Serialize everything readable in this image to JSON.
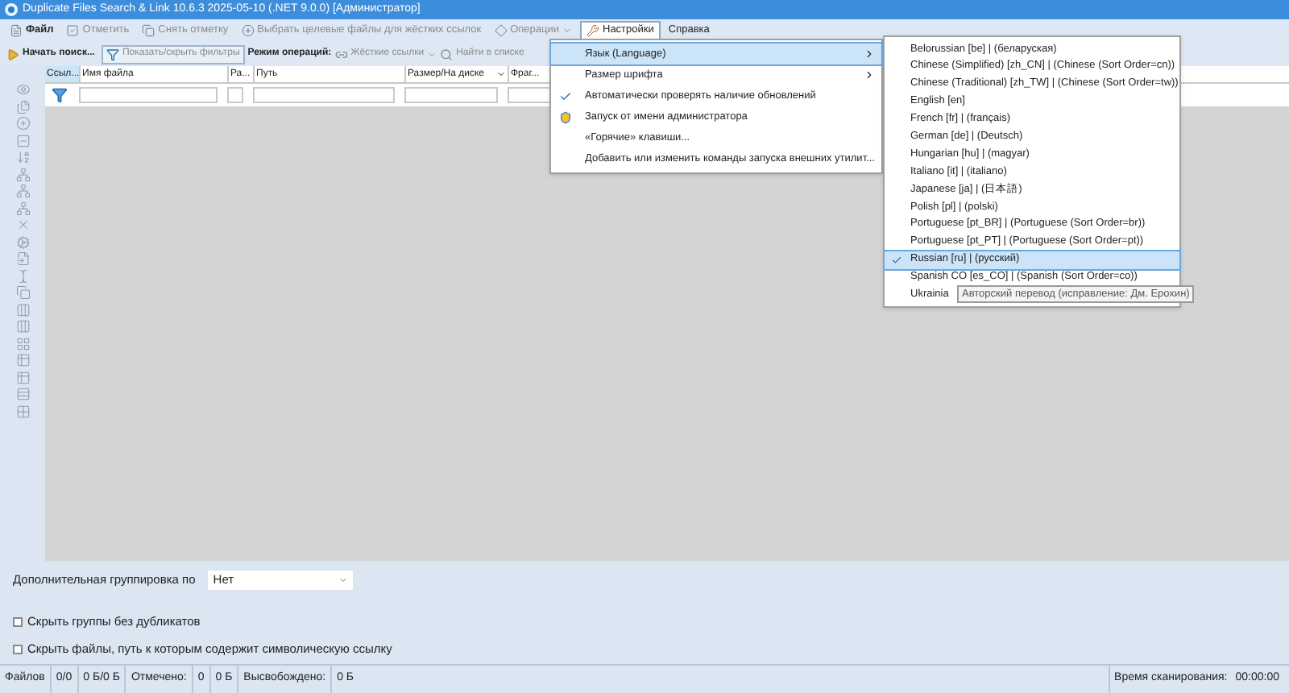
{
  "window": {
    "title": "Duplicate Files Search & Link 10.6.3 2025-05-10 (.NET 9.0.0) [Администратор]"
  },
  "menu_bar": [
    {
      "label": "Файл",
      "kind": "button",
      "disabled": false,
      "selected": false
    },
    {
      "label": "Отметить",
      "kind": "button",
      "disabled": true,
      "selected": false
    },
    {
      "label": "Снять отметку",
      "kind": "button",
      "disabled": true,
      "selected": false
    },
    {
      "label": "Выбрать целевые файлы для жёстких ссылок",
      "kind": "button",
      "disabled": true,
      "selected": false
    },
    {
      "label": "Операции",
      "kind": "dropdown",
      "disabled": true,
      "selected": false
    },
    {
      "label": "Настройки",
      "kind": "button",
      "disabled": false,
      "selected": true
    },
    {
      "label": "Справка",
      "kind": "plain",
      "disabled": false,
      "selected": false
    }
  ],
  "toolbar": {
    "start_search": "Начать поиск...",
    "filters_toggle": {
      "label": "Показать/скрыть фильтры",
      "disabled": true
    },
    "mode_label": "Режим операций:",
    "mode_value": {
      "label": "Жёсткие ссылки",
      "disabled": true
    },
    "find_in_list": {
      "label": "Найти в списке",
      "disabled": true
    }
  },
  "table": {
    "columns": [
      {
        "label": "Ссыл...",
        "selected": true
      },
      {
        "label": "Имя файла",
        "selected": false
      },
      {
        "label": "Ра...",
        "selected": false
      },
      {
        "label": "Путь",
        "selected": false
      },
      {
        "label": "Размер/На диске",
        "selected": false,
        "sortable": true
      },
      {
        "label": "Фраг...",
        "selected": false
      }
    ]
  },
  "settings_menu": [
    {
      "label": "Язык (Language)",
      "kind": "submenu",
      "selected": true
    },
    {
      "label": "Размер шрифта",
      "kind": "submenu",
      "selected": false
    },
    {
      "label": "Автоматически проверять наличие обновлений",
      "kind": "check",
      "selected": false,
      "checked": true
    },
    {
      "label": "Запуск от имени администратора",
      "kind": "shield",
      "selected": false
    },
    {
      "label": "«Горячие» клавиши...",
      "kind": "plain",
      "selected": false
    },
    {
      "label": "Добавить или изменить команды запуска внешних утилит...",
      "kind": "plain",
      "selected": false
    }
  ],
  "language_menu": [
    {
      "label": "Belorussian [be] | (беларуская)",
      "selected": false
    },
    {
      "label": "Chinese (Simplified) [zh_CN] | (Chinese (Sort Order=cn))",
      "selected": false
    },
    {
      "label": "Chinese (Traditional) [zh_TW] | (Chinese (Sort Order=tw))",
      "selected": false
    },
    {
      "label": "English [en]",
      "selected": false
    },
    {
      "label": "French [fr] | (français)",
      "selected": false
    },
    {
      "label": "German [de] | (Deutsch)",
      "selected": false
    },
    {
      "label": "Hungarian [hu] | (magyar)",
      "selected": false
    },
    {
      "label": "Italiano [it] | (italiano)",
      "selected": false
    },
    {
      "label": "Japanese [ja] | (日本語)",
      "selected": false
    },
    {
      "label": "Polish [pl] | (polski)",
      "selected": false
    },
    {
      "label": "Portuguese [pt_BR] | (Portuguese (Sort Order=br))",
      "selected": false
    },
    {
      "label": "Portuguese [pt_PT] | (Portuguese (Sort Order=pt))",
      "selected": false
    },
    {
      "label": "Russian [ru] | (русский)",
      "selected": true
    },
    {
      "label": "Spanish CO [es_CO] | (Spanish (Sort Order=co))",
      "selected": false
    },
    {
      "label": "Ukrainia",
      "selected": false
    }
  ],
  "tooltip": "Авторский перевод (исправление: Дм. Ерохин)",
  "grouping": {
    "label": "Дополнительная группировка по",
    "value": "Нет"
  },
  "options": [
    {
      "label": "Скрыть группы без дубликатов",
      "checked": false
    },
    {
      "label": "Скрыть файлы, путь к которым содержит символическую ссылку",
      "checked": false
    }
  ],
  "status_bar": {
    "files_label": "Файлов",
    "files_count": "0/0",
    "files_size": "0 Б/0 Б",
    "marked_label": "Отмечено:",
    "marked_count": "0",
    "marked_size": "0 Б",
    "freed_label": "Высвобождено:",
    "freed_size": "0 Б",
    "scan_time_label": "Время сканирования:",
    "scan_time": "00:00:00"
  }
}
